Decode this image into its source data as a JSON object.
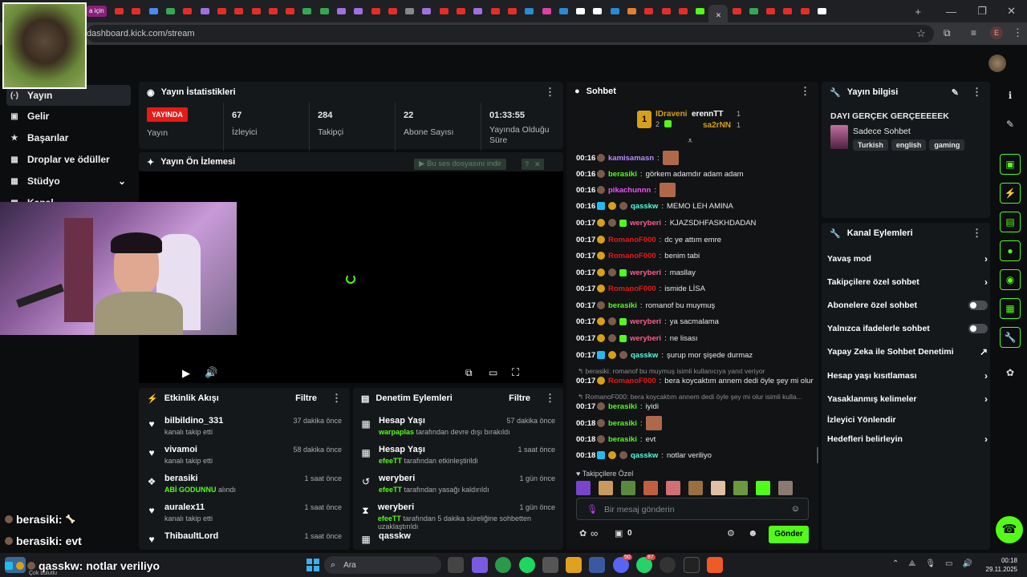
{
  "browser": {
    "url": "dashboard.kick.com/stream",
    "new_tab": "+",
    "win_min": "—",
    "win_max": "❐",
    "win_close": "✕",
    "tab_prefix": "a için"
  },
  "sidebar": {
    "items": [
      {
        "label": "Yayın",
        "icon": "broadcast-icon",
        "glyph": "(·)"
      },
      {
        "label": "Gelir",
        "icon": "dollar-icon",
        "glyph": "▣"
      },
      {
        "label": "Başarılar",
        "icon": "trophy-icon",
        "glyph": "🏆"
      },
      {
        "label": "Droplar ve ödüller",
        "icon": "gift-icon",
        "glyph": "▦"
      },
      {
        "label": "Stüdyo",
        "icon": "studio-icon",
        "glyph": "▦",
        "chevron": "⌄"
      },
      {
        "label": "Kanal",
        "icon": "channel-icon",
        "glyph": "▦",
        "chevron": "⌄"
      }
    ]
  },
  "stats_panel": {
    "title": "Yayın İstatistikleri",
    "live_badge": "YAYINDA",
    "live_label": "Yayın",
    "stats": [
      {
        "value": "67",
        "label": "İzleyici"
      },
      {
        "value": "284",
        "label": "Takipçi"
      },
      {
        "value": "22",
        "label": "Abone Sayısı"
      },
      {
        "value": "01:33:55",
        "label": "Yayında Olduğu Süre"
      }
    ]
  },
  "preview_panel": {
    "title": "Yayın Ön İzlemesi",
    "notice": "▶ Bu ses dosyasını indir",
    "notice_q": "?",
    "notice_x": "✕"
  },
  "activity_panel": {
    "title": "Etkinlik Akışı",
    "filter": "Filtre",
    "items": [
      {
        "icon": "heart-icon",
        "glyph": "♥",
        "name": "bilbildino_331",
        "desc": "kanalı takip etti",
        "time": "37 dakika önce"
      },
      {
        "icon": "heart-icon",
        "glyph": "♥",
        "name": "vivamoi",
        "desc": "kanalı takip etti",
        "time": "58 dakika önce"
      },
      {
        "icon": "reward-icon",
        "glyph": "❖",
        "name": "berasiki",
        "desc_highlight": "ABİ GODUNNU",
        "desc": "alındı",
        "time": "1 saat önce"
      },
      {
        "icon": "heart-icon",
        "glyph": "♥",
        "name": "auralex11",
        "desc": "kanalı takip etti",
        "time": "1 saat önce"
      },
      {
        "icon": "heart-icon",
        "glyph": "♥",
        "name": "ThibaultLord",
        "desc": "",
        "time": "1 saat önce"
      }
    ]
  },
  "mod_panel": {
    "title": "Denetim Eylemleri",
    "filter": "Filtre",
    "items": [
      {
        "icon": "calendar-icon",
        "glyph": "▦",
        "name": "Hesap Yaşı",
        "actor": "warpaplas",
        "desc": "tarafından devre dışı bırakıldı",
        "time": "57 dakika önce"
      },
      {
        "icon": "calendar-icon",
        "glyph": "▦",
        "name": "Hesap Yaşı",
        "actor": "efeeTT",
        "desc": "tarafından etkinleştirildi",
        "time": "1 saat önce"
      },
      {
        "icon": "undo-icon",
        "glyph": "↺",
        "name": "weryberi",
        "actor": "efeeTT",
        "desc": "tarafından yasağı kaldırıldı",
        "time": "1 gün önce"
      },
      {
        "icon": "hourglass-icon",
        "glyph": "⧗",
        "name": "weryberi",
        "actor": "efeeTT",
        "desc": "tarafından 5 dakika süreliğine sohbetten uzaklaştırıldı",
        "time": "1 gün önce"
      },
      {
        "icon": "calendar-icon",
        "glyph": "▦",
        "name": "qasskw",
        "actor": "",
        "desc": "",
        "time": ""
      }
    ]
  },
  "chat": {
    "title": "Sohbet",
    "leaderboard": [
      {
        "name": "IDraveni",
        "count": "2"
      },
      {
        "name": "erennTT",
        "count": "1"
      },
      {
        "name": "sa2rNN",
        "count": "1"
      }
    ],
    "messages": [
      {
        "time": "00:16",
        "user": "kamisamasn",
        "color": "#b78cff",
        "text": "",
        "badges": [
          "m"
        ],
        "emote": true
      },
      {
        "time": "00:16",
        "user": "berasiki",
        "color": "#53fc18",
        "text": "görkem adamdır adam adam",
        "badges": [
          "m"
        ]
      },
      {
        "time": "00:16",
        "user": "pikachunnn",
        "color": "#f052ff",
        "text": "",
        "badges": [
          "m"
        ],
        "emote": true
      },
      {
        "time": "00:16",
        "user": "qasskw",
        "color": "#53fce0",
        "text": "MEMO LEH AMINA",
        "badges": [
          "c",
          "b",
          "m"
        ]
      },
      {
        "time": "00:17",
        "user": "weryberi",
        "color": "#ff5c8a",
        "text": "KJAZSDHFASKHDADAN",
        "badges": [
          "b",
          "m",
          "g"
        ]
      },
      {
        "time": "00:17",
        "user": "RomanoF000",
        "color": "#e91916",
        "text": "dc ye attım emre",
        "badges": [
          "b"
        ]
      },
      {
        "time": "00:17",
        "user": "RomanoF000",
        "color": "#e91916",
        "text": "benim tabi",
        "badges": [
          "b"
        ]
      },
      {
        "time": "00:17",
        "user": "weryberi",
        "color": "#ff5c8a",
        "text": "masllay",
        "badges": [
          "b",
          "m",
          "g"
        ]
      },
      {
        "time": "00:17",
        "user": "RomanoF000",
        "color": "#e91916",
        "text": "ismide LİSA",
        "badges": [
          "b"
        ]
      },
      {
        "time": "00:17",
        "user": "berasiki",
        "color": "#53fc18",
        "text": "romanof bu muymuş",
        "badges": [
          "m"
        ]
      },
      {
        "time": "00:17",
        "user": "weryberi",
        "color": "#ff5c8a",
        "text": "ya sacmalama",
        "badges": [
          "b",
          "m",
          "g"
        ]
      },
      {
        "time": "00:17",
        "user": "weryberi",
        "color": "#ff5c8a",
        "text": "ne lisası",
        "badges": [
          "b",
          "m",
          "g"
        ]
      },
      {
        "time": "00:17",
        "user": "qasskw",
        "color": "#53fce0",
        "text": "şurup mor şişede durmaz",
        "badges": [
          "c",
          "b",
          "m"
        ]
      },
      {
        "reply": "berasiki: romanof bu muymuş isimli kullanıcıya yanıt veriyor"
      },
      {
        "time": "00:17",
        "user": "RomanoF000",
        "color": "#e91916",
        "text": "bera koycaktım annem dedi öyle şey mi olur",
        "badges": [
          "b"
        ]
      },
      {
        "reply": "RomanoF000: bera koycaktım annem dedi öyle şey mi olur isimli kulla..."
      },
      {
        "time": "00:17",
        "user": "berasiki",
        "color": "#53fc18",
        "text": "iyidi",
        "badges": [
          "m"
        ]
      },
      {
        "time": "00:18",
        "user": "berasiki",
        "color": "#53fc18",
        "text": "",
        "badges": [
          "m"
        ],
        "emote": true
      },
      {
        "time": "00:18",
        "user": "berasiki",
        "color": "#53fc18",
        "text": "evt",
        "badges": [
          "m"
        ]
      },
      {
        "time": "00:18",
        "user": "qasskw",
        "color": "#53fce0",
        "text": "notlar veriliyo",
        "badges": [
          "c",
          "b",
          "m"
        ]
      }
    ],
    "followers_only": "Takipçilere Özel",
    "input_placeholder": "Bir mesaj gönderin",
    "points": "0",
    "send": "Gönder",
    "infinity": "∞"
  },
  "stream_info": {
    "title_label": "Yayın bilgisi",
    "stream_title": "DAYI GERÇEK GERÇEEEEEK",
    "category": "Sadece Sohbet",
    "tags": [
      "Turkish",
      "english",
      "gaming"
    ]
  },
  "channel_actions": {
    "title": "Kanal Eylemleri",
    "items": [
      {
        "label": "Yavaş mod",
        "control": "chevron"
      },
      {
        "label": "Takipçilere özel sohbet",
        "control": "chevron"
      },
      {
        "label": "Abonelere özel sohbet",
        "control": "toggle"
      },
      {
        "label": "Yalnızca ifadelerle sohbet",
        "control": "toggle"
      },
      {
        "label": "Yapay Zeka ile Sohbet Denetimi",
        "control": "external"
      },
      {
        "label": "Hesap yaşı kısıtlaması",
        "control": "chevron"
      },
      {
        "label": "Yasaklanmış kelimeler",
        "control": "chevron"
      },
      {
        "label": "İzleyici Yönlendir",
        "control": "none"
      },
      {
        "label": "Hedefleri belirleyin",
        "control": "chevron"
      }
    ]
  },
  "overlay": {
    "line1_user": "berasiki:",
    "line2_user": "berasiki:",
    "line2_text": "evt",
    "line3_user": "qasskw:",
    "line3_text": "notlar veriliyo",
    "line3_tip": "Çok bulutlu"
  },
  "taskbar": {
    "search": "Ara",
    "time": "00:18",
    "date": "29.11.2025",
    "badge1": "50",
    "badge2": "87"
  },
  "colors": {
    "accent": "#53fc18",
    "live": "#e91916",
    "panel": "#15181b",
    "bg": "#0b0d0e"
  }
}
